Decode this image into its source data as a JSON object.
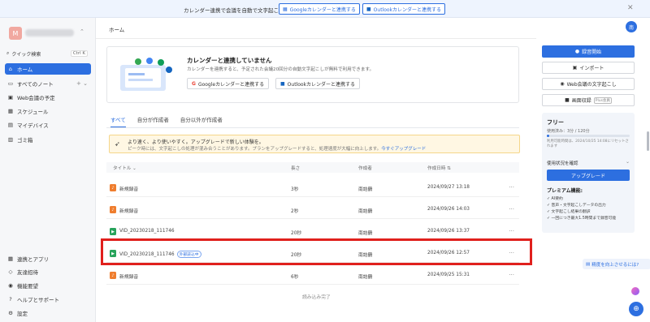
{
  "banner": {
    "text": "カレンダー連携で会議を自動で文字起こし",
    "google_btn": "Googleカレンダーと連携する",
    "outlook_btn": "Outlookカレンダーと連携する"
  },
  "sidebar": {
    "avatar_letter": "M",
    "search_label": "クイック検索",
    "search_shortcut": "Ctrl K",
    "items": [
      {
        "label": "ホーム",
        "icon": "home-icon",
        "glyph": "⌂"
      },
      {
        "label": "すべてのノート",
        "icon": "folder-icon",
        "glyph": "▭"
      },
      {
        "label": "Web会議の予定",
        "icon": "video-icon",
        "glyph": "▣"
      },
      {
        "label": "スケジュール",
        "icon": "calendar-icon",
        "glyph": "▦"
      },
      {
        "label": "マイデバイス",
        "icon": "device-icon",
        "glyph": "▤"
      },
      {
        "label": "ゴミ箱",
        "icon": "trash-icon",
        "glyph": "▥"
      }
    ],
    "bottom_items": [
      {
        "label": "連携とアプリ",
        "icon": "apps-icon",
        "glyph": "▦"
      },
      {
        "label": "友達招待",
        "icon": "gift-icon",
        "glyph": "◇"
      },
      {
        "label": "機能要望",
        "icon": "lightbulb-icon",
        "glyph": "◉"
      },
      {
        "label": "ヘルプとサポート",
        "icon": "help-icon",
        "glyph": "?"
      },
      {
        "label": "設定",
        "icon": "gear-icon",
        "glyph": "⚙"
      }
    ]
  },
  "main": {
    "breadcrumb": "ホーム",
    "calendar_card": {
      "title": "カレンダーと連携していません",
      "description": "カレンダーを連携すると、予定された会議20回分の自動文字起こしが無料で利用できます。",
      "google_btn": "Googleカレンダーと連携する",
      "outlook_btn": "Outlookカレンダーと連携する"
    },
    "tabs": [
      "すべて",
      "自分が作成者",
      "自分以外が作成者"
    ],
    "notice": {
      "line1": "より速く、より使いやすく。アップグレードで新しい体験を。",
      "line2": "ピーク時には、文字起こしの処理が混み合うことがあります。プランをアップグレードすると、処理速度が大幅に向上します。",
      "link": "今すぐアップグレード"
    },
    "table": {
      "columns": [
        "タイトル",
        "長さ",
        "作成者",
        "作成日時"
      ],
      "rows": [
        {
          "title": "新規録音",
          "length": "3秒",
          "creator": "南詰鶴",
          "date": "2024/09/27 13:18",
          "type": "audio",
          "tag": ""
        },
        {
          "title": "新規録音",
          "length": "2秒",
          "creator": "南詰鶴",
          "date": "2024/09/26 14:03",
          "type": "audio",
          "tag": ""
        },
        {
          "title": "VID_20230218_111746",
          "length": "20秒",
          "creator": "南詰鶴",
          "date": "2024/09/26 13:37",
          "type": "video",
          "tag": ""
        },
        {
          "title": "VID_20230218_111746",
          "length": "20秒",
          "creator": "南詰鶴",
          "date": "2024/09/26 12:57",
          "type": "video",
          "tag": "外部読込中"
        },
        {
          "title": "新規録音",
          "length": "6秒",
          "creator": "南詰鶴",
          "date": "2024/09/25 15:31",
          "type": "audio",
          "tag": ""
        }
      ]
    },
    "load_done": "読み込み完了"
  },
  "right_panel": {
    "user_initial": "南",
    "record_btn": "録音開始",
    "import_btn": "インポート",
    "web_btn": "Web会議の文字起こし",
    "video_btn": "画面収録",
    "video_tag": "Plus会員",
    "plan": {
      "title": "フリー",
      "usage": "使用済み：3分 / 120分",
      "usage_fraction": 0.025,
      "note": "利用可能時間は、2024/10/25 14:08にリセットされます",
      "usage_link": "使用状況を確認",
      "upgrade_btn": "アップグレード",
      "features_title": "プレミアム機能:",
      "features": [
        "AI要約",
        "音声・文字起こしデータの出力",
        "文字起こし結果の翻訳",
        "一回につき最大1.5時間まで録音可能"
      ]
    },
    "feedback": "精度を向上させるには?"
  },
  "colors": {
    "accent": "#2d6fe0",
    "highlight": "#e0201d",
    "audio": "#ef7d2e",
    "video": "#27a35b"
  }
}
